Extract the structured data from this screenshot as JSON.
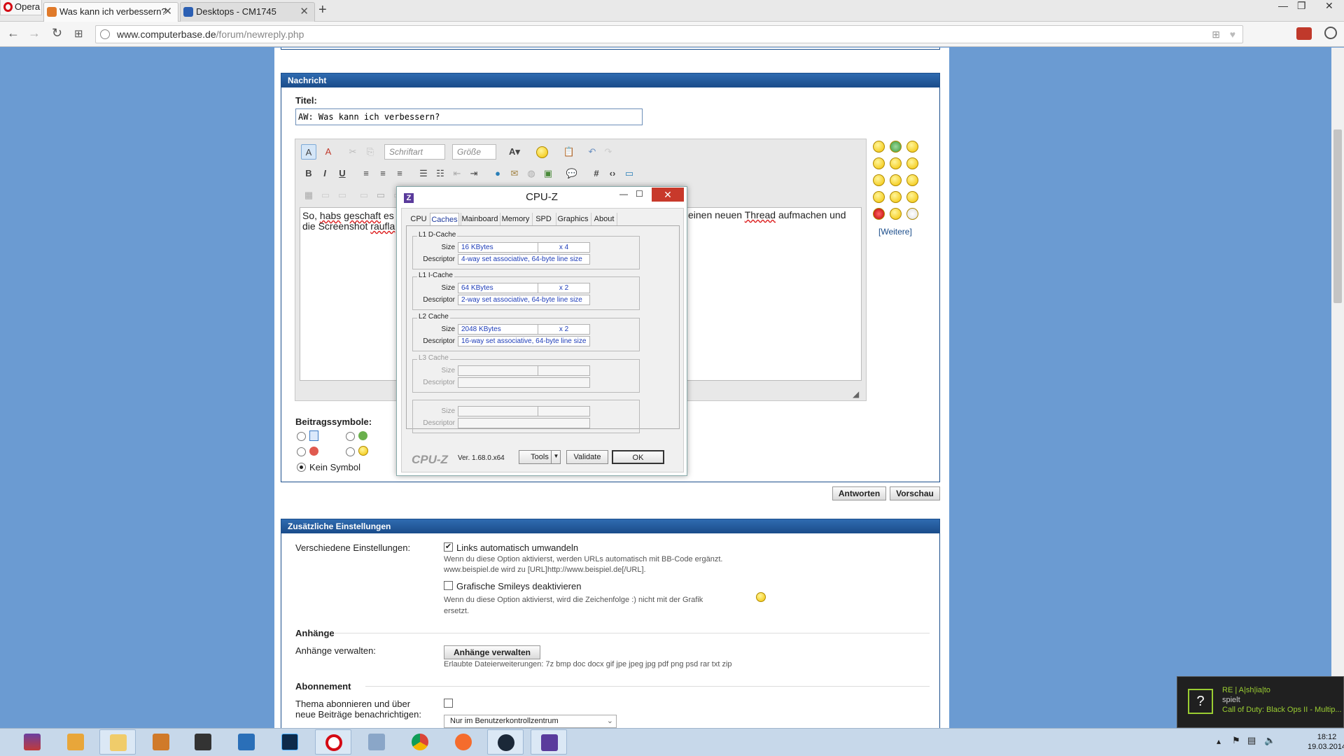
{
  "browser": {
    "menu_label": "Opera",
    "tabs": [
      {
        "label": "Was kann ich verbessern?",
        "active": true
      },
      {
        "label": "Desktops - CM1745",
        "active": false
      }
    ],
    "new_tab": "+",
    "url_host": "www.computerbase.de",
    "url_path": "/forum/newreply.php"
  },
  "nachricht": {
    "header": "Nachricht",
    "titel_label": "Titel:",
    "titel_value": "AW: Was kann ich verbessern?",
    "font_dropdown": "Schriftart",
    "size_dropdown": "Größe",
    "text_line1_start": "So, ",
    "text_line1_a": "habs",
    "text_line1_b": " ",
    "text_line1_c": "geschaft",
    "text_line1_d": " es",
    "text_line1_right": "einen neuen ",
    "text_line1_thread": "Thread",
    "text_line1_end": " aufmachen und",
    "text_line2_a": "die Screenshot ",
    "text_line2_b": "raufla",
    "smilies_more": "[Weitere]",
    "beitragssymbole_label": "Beitragssymbole:",
    "kein_symbol": "Kein Symbol",
    "antworten": "Antworten",
    "vorschau": "Vorschau"
  },
  "cpuz": {
    "title": "CPU-Z",
    "icon_letter": "Z",
    "tabs": [
      "CPU",
      "Caches",
      "Mainboard",
      "Memory",
      "SPD",
      "Graphics",
      "About"
    ],
    "active_tab": "Caches",
    "size_label": "Size",
    "descriptor_label": "Descriptor",
    "groups": [
      {
        "name": "L1 D-Cache",
        "size": "16 KBytes",
        "count": "x 4",
        "descriptor": "4-way set associative, 64-byte line size"
      },
      {
        "name": "L1 I-Cache",
        "size": "64 KBytes",
        "count": "x 2",
        "descriptor": "2-way set associative, 64-byte line size"
      },
      {
        "name": "L2 Cache",
        "size": "2048 KBytes",
        "count": "x 2",
        "descriptor": "16-way set associative, 64-byte line size"
      },
      {
        "name": "L3 Cache",
        "size": "",
        "count": "",
        "descriptor": ""
      },
      {
        "name": "",
        "size": "",
        "count": "",
        "descriptor": ""
      }
    ],
    "logo": "CPU-Z",
    "version": "Ver. 1.68.0.x64",
    "tools": "Tools",
    "validate": "Validate",
    "ok": "OK"
  },
  "settings": {
    "header": "Zusätzliche Einstellungen",
    "verschiedene_label": "Verschiedene Einstellungen:",
    "links_label": "Links automatisch umwandeln",
    "links_desc1": "Wenn du diese Option aktivierst, werden URLs automatisch mit BB-Code ergänzt.",
    "links_desc2": "www.beispiel.de wird zu [URL]http://www.beispiel.de[/URL].",
    "smileys_label": "Grafische Smileys deaktivieren",
    "smileys_desc1": "Wenn du diese Option aktivierst, wird die Zeichenfolge :) nicht mit der Grafik",
    "smileys_desc2": "ersetzt.",
    "anhaenge_heading": "Anhänge",
    "anhaenge_label": "Anhänge verwalten:",
    "anhaenge_button": "Anhänge verwalten",
    "anhaenge_ext": "Erlaubte Dateierweiterungen: 7z bmp doc docx gif jpe jpeg jpg pdf png psd rar txt zip",
    "abonnement_heading": "Abonnement",
    "abonnement_label1": "Thema abonnieren und über",
    "abonnement_label2": "neue Beiträge benachrichtigen:",
    "abonnement_select": "Nur im Benutzerkontrollzentrum"
  },
  "notification": {
    "icon": "?",
    "name": "RE | A|sh|ia|to",
    "status": "spielt",
    "game": "Call of Duty: Black Ops II - Multip..."
  },
  "taskbar": {
    "apps": [
      "winrar",
      "folder-app",
      "explorer",
      "network-app",
      "terminal",
      "media-player",
      "photoshop",
      "opera",
      "control-panel",
      "chrome",
      "origin",
      "steam",
      "cpuz"
    ],
    "time": "18:12",
    "date": "19.03.2014"
  },
  "colors": {
    "page_bg": "#6b9bd2",
    "panel_head": "#1a4c8a",
    "cpuz_value": "#1d3cb8",
    "close_red": "#c8392b"
  }
}
